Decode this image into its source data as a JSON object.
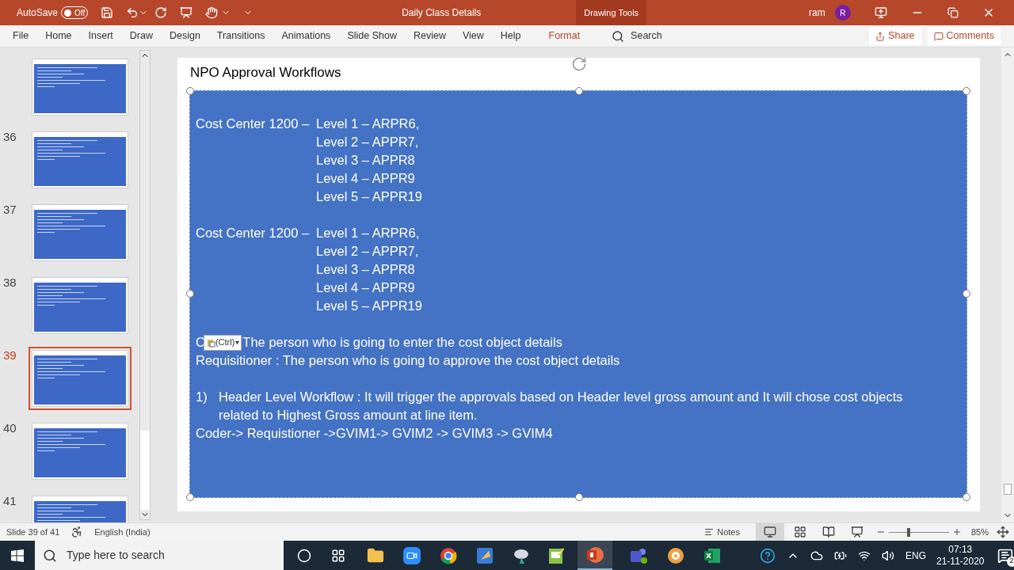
{
  "window": {
    "autosave_label": "AutoSave",
    "autosave_on": false,
    "autosave_state": "Off",
    "title": "Daily Class Details",
    "context_tab": "Drawing Tools",
    "user": "ram",
    "user_initial": "R"
  },
  "ribbon_tabs": [
    {
      "label": "File",
      "selected": false
    },
    {
      "label": "Home",
      "selected": false
    },
    {
      "label": "Insert",
      "selected": false
    },
    {
      "label": "Draw",
      "selected": false
    },
    {
      "label": "Design",
      "selected": false
    },
    {
      "label": "Transitions",
      "selected": false
    },
    {
      "label": "Animations",
      "selected": false
    },
    {
      "label": "Slide Show",
      "selected": false
    },
    {
      "label": "Review",
      "selected": false
    },
    {
      "label": "View",
      "selected": false
    },
    {
      "label": "Help",
      "selected": false
    },
    {
      "label": "Format",
      "selected": false,
      "kind": "contextual"
    }
  ],
  "ribbon_search": "Search",
  "share": "Share",
  "comments": "Comments",
  "slides": [
    {
      "selected": false
    },
    {
      "number": "36",
      "selected": false
    },
    {
      "number": "37",
      "selected": false
    },
    {
      "number": "38",
      "selected": false
    },
    {
      "number": "39",
      "selected": true
    },
    {
      "number": "40",
      "selected": false
    },
    {
      "number": "41",
      "selected": false
    }
  ],
  "slide": {
    "title": "NPO Approval Workflows",
    "groups": [
      {
        "label": "Cost Center 1200 –",
        "levels": [
          "Level 1 – ARPR6,",
          "Level 2 – APPR7,",
          "Level 3 – APPR8",
          "Level 4 – APPR9",
          "Level 5 – APPR19"
        ]
      },
      {
        "label": "Cost Center 1200 –",
        "levels": [
          "Level 1 – ARPR6,",
          "Level 2 – APPR7,",
          "Level 3 – APPR8",
          "Level 4 – APPR9",
          "Level 5 – APPR19"
        ]
      }
    ],
    "coder_prefix": "C",
    "paste_badge": "(Ctrl)",
    "coder_text": "The person who is going to enter the cost object details",
    "requisitioner": "Requisitioner : The person who is going to approve the cost object details",
    "list_item": {
      "marker": "1)",
      "text": "Header Level Workflow : It will trigger the approvals based on Header level gross amount and It will chose cost objects related to Highest Gross amount at line item."
    },
    "flow": "Coder-> Requistioner ->GVIM1-> GVIM2 -> GVIM3 -> GVIM4"
  },
  "status_bar": {
    "slide_info": "Slide 39 of 41",
    "language": "English (India)",
    "notes": "Notes",
    "zoom": {
      "level": 0.3
    },
    "zoom_text": "85%"
  },
  "taskbar": {
    "search_placeholder": "Type here to search",
    "language": "ENG",
    "time": "07:13",
    "date": "21-11-2020",
    "notifications": "2"
  }
}
